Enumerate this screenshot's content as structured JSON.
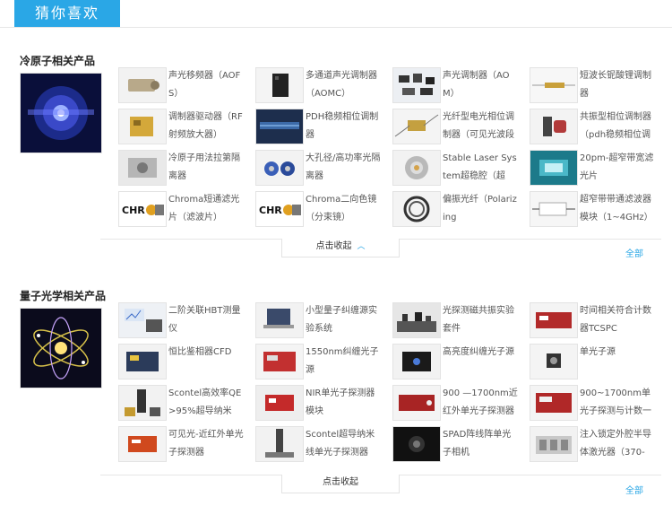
{
  "header": {
    "tab_label": "猜你喜欢"
  },
  "sections": [
    {
      "title": "冷原子相关产品",
      "collapse_label": "点击收起",
      "all_label": "全部",
      "items": [
        {
          "name": "声光移频器（AOFS）",
          "thumb": "aofs"
        },
        {
          "name": "多通道声光调制器（AOMC）",
          "thumb": "box-black"
        },
        {
          "name": "声光调制器（AOM）",
          "thumb": "modules"
        },
        {
          "name": "短波长铌酸锂调制器",
          "thumb": "fiber-rod"
        },
        {
          "name": "调制器驱动器（RF射频放大器）",
          "thumb": "gold-board"
        },
        {
          "name": "PDH稳频相位调制器",
          "thumb": "dark-panel"
        },
        {
          "name": "光纤型电光相位调制器（可见光波段",
          "thumb": "gold-fiber"
        },
        {
          "name": "共振型相位调制器（pdh稳频相位调",
          "thumb": "resonant"
        },
        {
          "name": "冷原子用法拉第隔离器",
          "thumb": "metal-block"
        },
        {
          "name": "大孔径/高功率光隔离器",
          "thumb": "blue-iso"
        },
        {
          "name": "Stable Laser System超稳腔（超",
          "thumb": "cavity"
        },
        {
          "name": "20pm-超窄带宽滤光片",
          "thumb": "filter-chip"
        },
        {
          "name": "Chroma短通滤光片（滤波片）",
          "thumb": "chroma"
        },
        {
          "name": "Chroma二向色镜（分束镜）",
          "thumb": "chroma"
        },
        {
          "name": "偏振光纤（Polarizing",
          "thumb": "fiber-coil"
        },
        {
          "name": "超窄带带通滤波器模块（1~4GHz）",
          "thumb": "white-module"
        }
      ]
    },
    {
      "title": "量子光学相关产品",
      "collapse_label": "点击收起",
      "all_label": "全部",
      "items": [
        {
          "name": "二阶关联HBT测量仪",
          "thumb": "hbt"
        },
        {
          "name": "小型量子纠缠源实验系统",
          "thumb": "laptop"
        },
        {
          "name": "光探测磁共振实验套件",
          "thumb": "optics-table"
        },
        {
          "name": "时间相关符合计数器TCSPC",
          "thumb": "red-box"
        },
        {
          "name": "恒比鉴相器CFD",
          "thumb": "cfd"
        },
        {
          "name": "1550nm纠缠光子源",
          "thumb": "red-box2"
        },
        {
          "name": "高亮度纠缠光子源",
          "thumb": "dark-device"
        },
        {
          "name": "单光子源",
          "thumb": "cube-lens"
        },
        {
          "name": "Scontel高效率QE>95%超导纳米",
          "thumb": "scontel"
        },
        {
          "name": "NIR单光子探测器模块",
          "thumb": "nir"
        },
        {
          "name": "900 —1700nm近红外单光子探测器",
          "thumb": "red-box3"
        },
        {
          "name": "900~1700nm单光子探测与计数一体",
          "thumb": "red-box4"
        },
        {
          "name": "可见光-近红外单光子探测器",
          "thumb": "orange-box"
        },
        {
          "name": "Scontel超导纳米线单光子探测器",
          "thumb": "scontel2"
        },
        {
          "name": "SPAD阵线阵单光子相机",
          "thumb": "spad"
        },
        {
          "name": "注入锁定外腔半导体激光器（370-",
          "thumb": "laser-rack"
        }
      ]
    }
  ]
}
